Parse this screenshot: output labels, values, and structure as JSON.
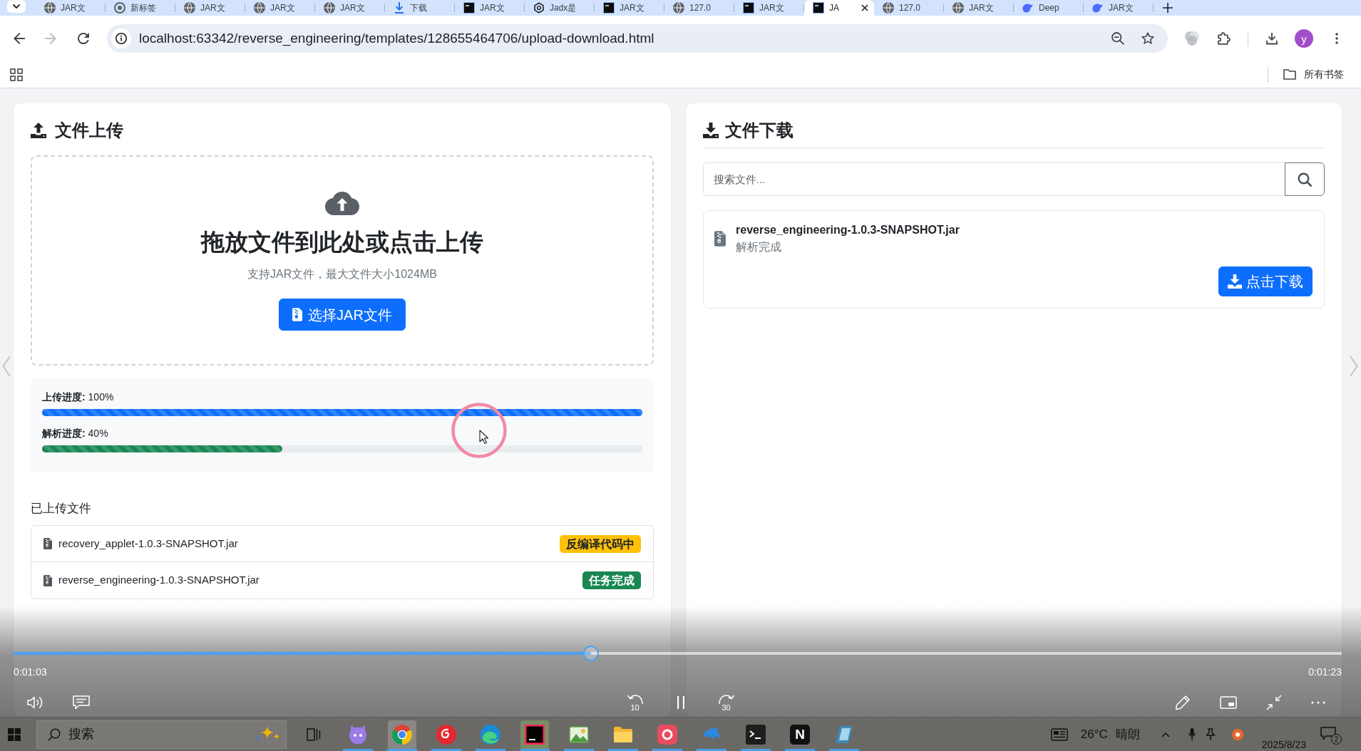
{
  "browser": {
    "tabs": [
      {
        "label": "JAR文",
        "kind": "globe",
        "selected": false
      },
      {
        "label": "新标签",
        "kind": "ring",
        "selected": false
      },
      {
        "label": "JAR文",
        "kind": "globe",
        "selected": false
      },
      {
        "label": "JAR文",
        "kind": "globe",
        "selected": false
      },
      {
        "label": "JAR文",
        "kind": "globe",
        "selected": false
      },
      {
        "label": "下载",
        "kind": "download",
        "selected": false
      },
      {
        "label": "JAR文",
        "kind": "terminal",
        "selected": false
      },
      {
        "label": "Jadx是",
        "kind": "knot",
        "selected": false
      },
      {
        "label": "JAR文",
        "kind": "terminal",
        "selected": false
      },
      {
        "label": "127.0",
        "kind": "globe",
        "selected": false
      },
      {
        "label": "JAR文",
        "kind": "terminal",
        "selected": false
      },
      {
        "label": "JA",
        "kind": "terminal",
        "selected": true
      },
      {
        "label": "127.0",
        "kind": "globe",
        "selected": false
      },
      {
        "label": "JAR文",
        "kind": "globe",
        "selected": false
      },
      {
        "label": "Deep",
        "kind": "whale",
        "selected": false
      },
      {
        "label": "JAR文",
        "kind": "whale",
        "selected": false
      }
    ],
    "nav_buttons": [
      {
        "kind": "back",
        "disabled": false
      },
      {
        "kind": "forward",
        "disabled": true
      },
      {
        "kind": "reload",
        "disabled": false
      }
    ],
    "url": "localhost:63342/reverse_engineering/templates/128655464706/upload-download.html",
    "profile_initial": "y",
    "bookmarks_folder": "所有书签"
  },
  "upload": {
    "title": "文件上传",
    "dropzone": {
      "heading": "拖放文件到此处或点击上传",
      "hint": "支持JAR文件，最大文件大小1024MB",
      "button": "选择JAR文件"
    },
    "progress": [
      {
        "text": "**上传进度:** 100%",
        "level": 1,
        "color": "#0d6efd"
      },
      {
        "text": "**解析进度:** 40%",
        "level": 0.4,
        "color": "#198754"
      }
    ],
    "files_heading": "已上传文件",
    "files": [
      {
        "name": "recovery_applet-1.0.3-SNAPSHOT.jar",
        "status": "反编译代码中",
        "color": "#ffc107"
      },
      {
        "name": "reverse_engineering-1.0.3-SNAPSHOT.jar",
        "status": "任务完成",
        "color": "#198754"
      }
    ]
  },
  "download": {
    "title": "文件下载",
    "search": {
      "placeholder": "搜索文件..."
    },
    "files": [
      {
        "name": "reverse_engineering-1.0.3-SNAPSHOT.jar",
        "status": "解析完成",
        "button": "点击下载"
      }
    ]
  },
  "video_player": {
    "level": 0.435,
    "elapsed": "0:01:03",
    "total": "0:01:23",
    "skip_back": "10",
    "skip_forward": "30"
  },
  "taskbar": {
    "search": {
      "placeholder": "搜索"
    },
    "apps": [
      {
        "kind": "cat",
        "selected": false,
        "attention": false,
        "running": true
      },
      {
        "kind": "browser",
        "selected": true,
        "attention": false,
        "running": true
      },
      {
        "kind": "disc",
        "selected": false,
        "attention": false,
        "running": true
      },
      {
        "kind": "wave-browser",
        "selected": false,
        "attention": false,
        "running": true
      },
      {
        "kind": "ide",
        "selected": false,
        "attention": true,
        "running": true
      },
      {
        "kind": "picture",
        "selected": false,
        "attention": false,
        "running": true
      },
      {
        "kind": "folder",
        "selected": false,
        "attention": false,
        "running": true
      },
      {
        "kind": "rounded-app",
        "selected": false,
        "attention": false,
        "running": true
      },
      {
        "kind": "dolphin",
        "selected": false,
        "attention": false,
        "running": true
      },
      {
        "kind": "terminal",
        "selected": false,
        "attention": false,
        "running": true
      },
      {
        "kind": "letter",
        "label": "N",
        "selected": false,
        "attention": false,
        "running": true
      },
      {
        "kind": "notebook",
        "selected": false,
        "attention": false,
        "running": true
      }
    ],
    "weather": {
      "temperature": "26°C",
      "condition": "晴朗"
    },
    "date": "2025/8/23",
    "notification_count": "2"
  }
}
